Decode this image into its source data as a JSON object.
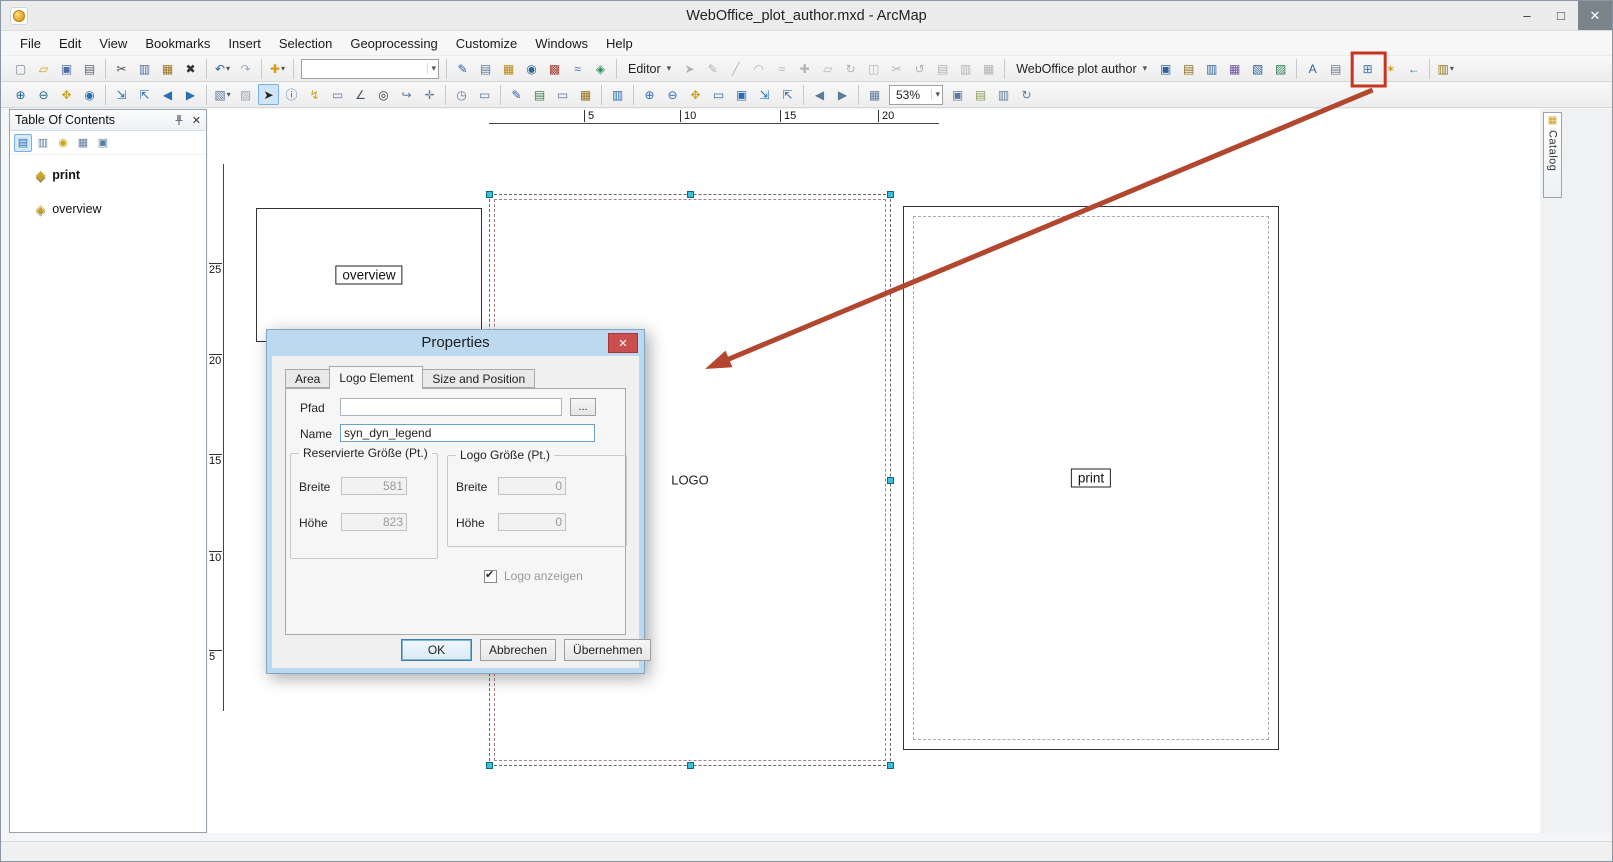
{
  "window": {
    "title": "WebOffice_plot_author.mxd - ArcMap",
    "minimize_glyph": "–",
    "maximize_glyph": "□",
    "close_glyph": "✕"
  },
  "menubar": {
    "items": [
      "File",
      "Edit",
      "View",
      "Bookmarks",
      "Insert",
      "Selection",
      "Geoprocessing",
      "Customize",
      "Windows",
      "Help"
    ]
  },
  "toolbars": {
    "row1": [
      {
        "type": "icons",
        "items": [
          {
            "name": "new-document-icon",
            "glyph": "▢",
            "color": "#7a8694"
          },
          {
            "name": "open-folder-icon",
            "glyph": "▱",
            "color": "#c9a227"
          },
          {
            "name": "save-icon",
            "glyph": "▣",
            "color": "#4a6fa5"
          },
          {
            "name": "print-icon",
            "glyph": "▤",
            "color": "#5a6572"
          }
        ]
      },
      {
        "type": "sep"
      },
      {
        "type": "icons",
        "items": [
          {
            "name": "cut-icon",
            "glyph": "✂",
            "color": "#4a4a4a"
          },
          {
            "name": "copy-icon",
            "glyph": "▥",
            "color": "#4a6fa5"
          },
          {
            "name": "paste-icon",
            "glyph": "▦",
            "color": "#96701d"
          },
          {
            "name": "delete-icon",
            "glyph": "✖",
            "color": "#333333"
          }
        ]
      },
      {
        "type": "sep"
      },
      {
        "type": "icons",
        "items": [
          {
            "name": "undo-icon",
            "glyph": "↶",
            "color": "#2a5db0",
            "dropdown": true
          },
          {
            "name": "redo-icon",
            "glyph": "↷",
            "color": "#9aa7c0"
          }
        ]
      },
      {
        "type": "sep"
      },
      {
        "type": "icons",
        "items": [
          {
            "name": "add-data-icon",
            "glyph": "✚",
            "color": "#d49a17",
            "dropdown": true
          }
        ]
      },
      {
        "type": "sep"
      },
      {
        "type": "combo",
        "name": "map-scale-combo",
        "value": "",
        "width": 138
      },
      {
        "type": "sep"
      },
      {
        "type": "icons",
        "items": [
          {
            "name": "editor-toolbar-icon",
            "glyph": "✎",
            "color": "#2a5db0"
          },
          {
            "name": "table-of-contents-icon",
            "glyph": "▤",
            "color": "#5b7a9d"
          },
          {
            "name": "catalog-window-icon",
            "glyph": "▦",
            "color": "#b8860b"
          },
          {
            "name": "search-window-icon",
            "glyph": "◉",
            "color": "#33678f"
          },
          {
            "name": "arctoolbox-icon",
            "glyph": "▩",
            "color": "#a33c2f"
          },
          {
            "name": "python-window-icon",
            "glyph": "≈",
            "color": "#3a6fae"
          },
          {
            "name": "modelbuilder-icon",
            "glyph": "◈",
            "color": "#2f8f5b"
          }
        ]
      },
      {
        "type": "sep"
      },
      {
        "type": "dropdown",
        "name": "editor-menu-dropdown",
        "label": "Editor"
      },
      {
        "type": "icons",
        "items": [
          {
            "name": "edit-tool-icon",
            "glyph": "➤",
            "color": "#b3b3b3"
          },
          {
            "name": "edit-annotation-tool-icon",
            "glyph": "✎",
            "color": "#b3b3b3"
          },
          {
            "name": "straight-segment-icon",
            "glyph": "╱",
            "color": "#b3b3b3"
          },
          {
            "name": "endpoint-arc-icon",
            "glyph": "◠",
            "color": "#b3b3b3"
          },
          {
            "name": "trace-tool-icon",
            "glyph": "≈",
            "color": "#b3b3b3"
          },
          {
            "name": "point-tool-icon",
            "glyph": "✚",
            "color": "#b3b3b3"
          },
          {
            "name": "edit-vertices-icon",
            "glyph": "▱",
            "color": "#b3b3b3"
          },
          {
            "name": "reshape-feature-icon",
            "glyph": "↻",
            "color": "#b3b3b3"
          },
          {
            "name": "cut-polygons-icon",
            "glyph": "◫",
            "color": "#b3b3b3"
          },
          {
            "name": "split-tool-icon",
            "glyph": "✂",
            "color": "#b3b3b3"
          },
          {
            "name": "rotate-tool-icon",
            "glyph": "↺",
            "color": "#b3b3b3"
          },
          {
            "name": "attributes-icon",
            "glyph": "▤",
            "color": "#b3b3b3"
          },
          {
            "name": "sketch-properties-icon",
            "glyph": "▥",
            "color": "#b3b3b3"
          },
          {
            "name": "create-features-icon",
            "glyph": "▦",
            "color": "#b3b3b3"
          }
        ]
      },
      {
        "type": "sep"
      },
      {
        "type": "dropdown",
        "name": "weboffice-plot-author-dropdown",
        "label": "WebOffice plot author"
      },
      {
        "type": "icons",
        "items": [
          {
            "name": "wo-plot-settings-icon",
            "glyph": "▣",
            "color": "#31639c"
          },
          {
            "name": "wo-plot-template-icon",
            "glyph": "▤",
            "color": "#8a6d1d"
          },
          {
            "name": "wo-plot-extent-icon",
            "glyph": "▥",
            "color": "#31639c"
          },
          {
            "name": "wo-plot-frame-icon",
            "glyph": "▦",
            "color": "#6a4b9c"
          },
          {
            "name": "wo-plot-print-icon",
            "glyph": "▧",
            "color": "#31639c"
          },
          {
            "name": "wo-plot-export-icon",
            "glyph": "▨",
            "color": "#2f7d4f"
          }
        ]
      },
      {
        "type": "sep"
      },
      {
        "type": "icons",
        "items": [
          {
            "name": "text-element-icon",
            "glyph": "A",
            "color": "#31639c"
          },
          {
            "name": "legend-element-icon",
            "glyph": "▤",
            "color": "#6b7a8d"
          }
        ]
      },
      {
        "type": "sep"
      },
      {
        "type": "icons",
        "items": [
          {
            "name": "logo-element-icon",
            "glyph": "⊞",
            "color": "#3a6fae"
          },
          {
            "name": "north-arrow-icon",
            "glyph": "✶",
            "color": "#c9a227"
          },
          {
            "name": "back-arrow-icon",
            "glyph": "←",
            "color": "#1b8a99"
          }
        ]
      },
      {
        "type": "sep"
      },
      {
        "type": "icons",
        "items": [
          {
            "name": "report-icon",
            "glyph": "▥",
            "color": "#96701d",
            "dropdown": true
          }
        ]
      }
    ],
    "row2": [
      {
        "type": "icons",
        "items": [
          {
            "name": "zoom-in-icon",
            "glyph": "⊕",
            "color": "#1f5f8b"
          },
          {
            "name": "zoom-out-icon",
            "glyph": "⊖",
            "color": "#1f5f8b"
          },
          {
            "name": "pan-icon",
            "glyph": "✥",
            "color": "#caa21a"
          },
          {
            "name": "full-extent-icon",
            "glyph": "◉",
            "color": "#2a6db5"
          }
        ]
      },
      {
        "type": "sep"
      },
      {
        "type": "icons",
        "items": [
          {
            "name": "fixed-zoom-in-icon",
            "glyph": "⇲",
            "color": "#2a6db5"
          },
          {
            "name": "fixed-zoom-out-icon",
            "glyph": "⇱",
            "color": "#2a6db5"
          },
          {
            "name": "back-extent-icon",
            "glyph": "◀",
            "color": "#2a6db5"
          },
          {
            "name": "forward-extent-icon",
            "glyph": "▶",
            "color": "#2a6db5"
          }
        ]
      },
      {
        "type": "sep"
      },
      {
        "type": "icons",
        "items": [
          {
            "name": "select-features-icon",
            "glyph": "▧",
            "color": "#5b7a9d",
            "dropdown": true
          },
          {
            "name": "clear-selection-icon",
            "glyph": "▨",
            "color": "#9aa7b5"
          },
          {
            "name": "select-elements-icon",
            "glyph": "➤",
            "color": "#222222",
            "pressed": true
          },
          {
            "name": "identify-icon",
            "glyph": "ⓘ",
            "color": "#2a6db5"
          },
          {
            "name": "hyperlink-icon",
            "glyph": "↯",
            "color": "#caa21a"
          },
          {
            "name": "html-popup-icon",
            "glyph": "▭",
            "color": "#5b7a9d"
          },
          {
            "name": "measure-icon",
            "glyph": "∠",
            "color": "#445566"
          },
          {
            "name": "find-icon",
            "glyph": "◎",
            "color": "#333333"
          },
          {
            "name": "find-route-icon",
            "glyph": "↪",
            "color": "#5b7a9d"
          },
          {
            "name": "go-to-xy-icon",
            "glyph": "✛",
            "color": "#5b7a9d"
          }
        ]
      },
      {
        "type": "sep"
      },
      {
        "type": "icons",
        "items": [
          {
            "name": "time-slider-icon",
            "glyph": "◷",
            "color": "#5b7a9d"
          },
          {
            "name": "create-viewer-window-icon",
            "glyph": "▭",
            "color": "#5b7a9d"
          }
        ]
      },
      {
        "type": "sep"
      },
      {
        "type": "icons",
        "items": [
          {
            "name": "new-graphic-icon",
            "glyph": "✎",
            "color": "#2a5db0"
          },
          {
            "name": "open-attribute-table-icon",
            "glyph": "▤",
            "color": "#3f7d4f"
          },
          {
            "name": "viewer-icon",
            "glyph": "▭",
            "color": "#5b7a9d"
          },
          {
            "name": "picture-icon",
            "glyph": "▦",
            "color": "#96701d"
          }
        ]
      },
      {
        "type": "sep"
      },
      {
        "type": "icons",
        "items": [
          {
            "name": "copy-map-icon",
            "glyph": "▥",
            "color": "#2a6db5"
          }
        ]
      },
      {
        "type": "sep"
      },
      {
        "type": "icons",
        "items": [
          {
            "name": "layout-zoom-in-icon",
            "glyph": "⊕",
            "color": "#2a6db5"
          },
          {
            "name": "layout-zoom-out-icon",
            "glyph": "⊖",
            "color": "#2a6db5"
          },
          {
            "name": "layout-pan-icon",
            "glyph": "✥",
            "color": "#caa21a"
          },
          {
            "name": "layout-zoom-whole-page-icon",
            "glyph": "▭",
            "color": "#2a6db5"
          },
          {
            "name": "layout-zoom-100-icon",
            "glyph": "▣",
            "color": "#2a6db5"
          },
          {
            "name": "layout-fixed-zoom-in-icon",
            "glyph": "⇲",
            "color": "#2a6db5"
          },
          {
            "name": "layout-fixed-zoom-out-icon",
            "glyph": "⇱",
            "color": "#2a6db5"
          }
        ]
      },
      {
        "type": "sep"
      },
      {
        "type": "icons",
        "items": [
          {
            "name": "layout-go-back-extent-icon",
            "glyph": "◀",
            "color": "#5b7a9d"
          },
          {
            "name": "layout-go-forward-extent-icon",
            "glyph": "▶",
            "color": "#5b7a9d"
          }
        ]
      },
      {
        "type": "sep"
      },
      {
        "type": "icons",
        "items": [
          {
            "name": "toggle-draft-mode-icon",
            "glyph": "▦",
            "color": "#5b7a9d"
          }
        ]
      },
      {
        "type": "combo",
        "name": "layout-zoom-percent-combo",
        "value": "53%",
        "width": 54
      },
      {
        "type": "icons",
        "items": [
          {
            "name": "focus-data-frame-icon",
            "glyph": "▣",
            "color": "#5b7a9d"
          },
          {
            "name": "change-layout-icon",
            "glyph": "▤",
            "color": "#8aa05a"
          },
          {
            "name": "data-driven-pages-icon",
            "glyph": "▥",
            "color": "#5b7a9d"
          },
          {
            "name": "refresh-view-icon",
            "glyph": "↻",
            "color": "#5b7a9d"
          }
        ]
      }
    ]
  },
  "toc": {
    "title": "Table Of Contents",
    "close_glyph": "✕",
    "tools": [
      {
        "name": "list-by-drawing-order-icon",
        "glyph": "▤",
        "color": "#2a6db5",
        "pressed": true
      },
      {
        "name": "list-by-source-icon",
        "glyph": "▥",
        "color": "#5b7a9d"
      },
      {
        "name": "list-by-visibility-icon",
        "glyph": "◉",
        "color": "#caa21a"
      },
      {
        "name": "list-by-selection-icon",
        "glyph": "▦",
        "color": "#5b7a9d"
      },
      {
        "name": "toc-options-icon",
        "glyph": "▣",
        "color": "#5b7a9d"
      }
    ],
    "layer_glyph": "◈",
    "items": [
      {
        "label": "print",
        "bold": true
      },
      {
        "label": "overview",
        "bold": false
      }
    ]
  },
  "canvas": {
    "ruler_top_labels": [
      "5",
      "10",
      "15",
      "20"
    ],
    "ruler_left_labels": [
      "25",
      "20",
      "15",
      "10",
      "5"
    ],
    "overview_frame_label": "overview",
    "logo_label": "LOGO",
    "print_label": "print"
  },
  "catalog": {
    "label": "Catalog",
    "icon_glyph": "▦"
  },
  "dialog": {
    "title": "Properties",
    "close_glyph": "✕",
    "tabs": [
      {
        "label": "Area",
        "active": false
      },
      {
        "label": "Logo Element",
        "active": true
      },
      {
        "label": "Size and Position",
        "active": false
      }
    ],
    "pfad_label": "Pfad",
    "pfad_value": "",
    "browse_label": "...",
    "name_label": "Name",
    "name_value": "syn_dyn_legend",
    "group_reserved": "Reservierte Größe (Pt.)",
    "group_logo": "Logo Größe (Pt.)",
    "breite_label": "Breite",
    "hoehe_label": "Höhe",
    "reserved_breite_value": "581",
    "reserved_hoehe_value": "823",
    "logo_breite_value": "0",
    "logo_hoehe_value": "0",
    "checkbox_label": "Logo anzeigen",
    "checkbox_checked": true,
    "check_glyph": "✔",
    "buttons": [
      {
        "label": "OK",
        "default": true
      },
      {
        "label": "Abbrechen",
        "default": false
      },
      {
        "label": "Übernehmen",
        "default": false
      }
    ]
  },
  "annotation": {
    "box_color": "#c8341f",
    "arrow_color": "#b2462e"
  }
}
